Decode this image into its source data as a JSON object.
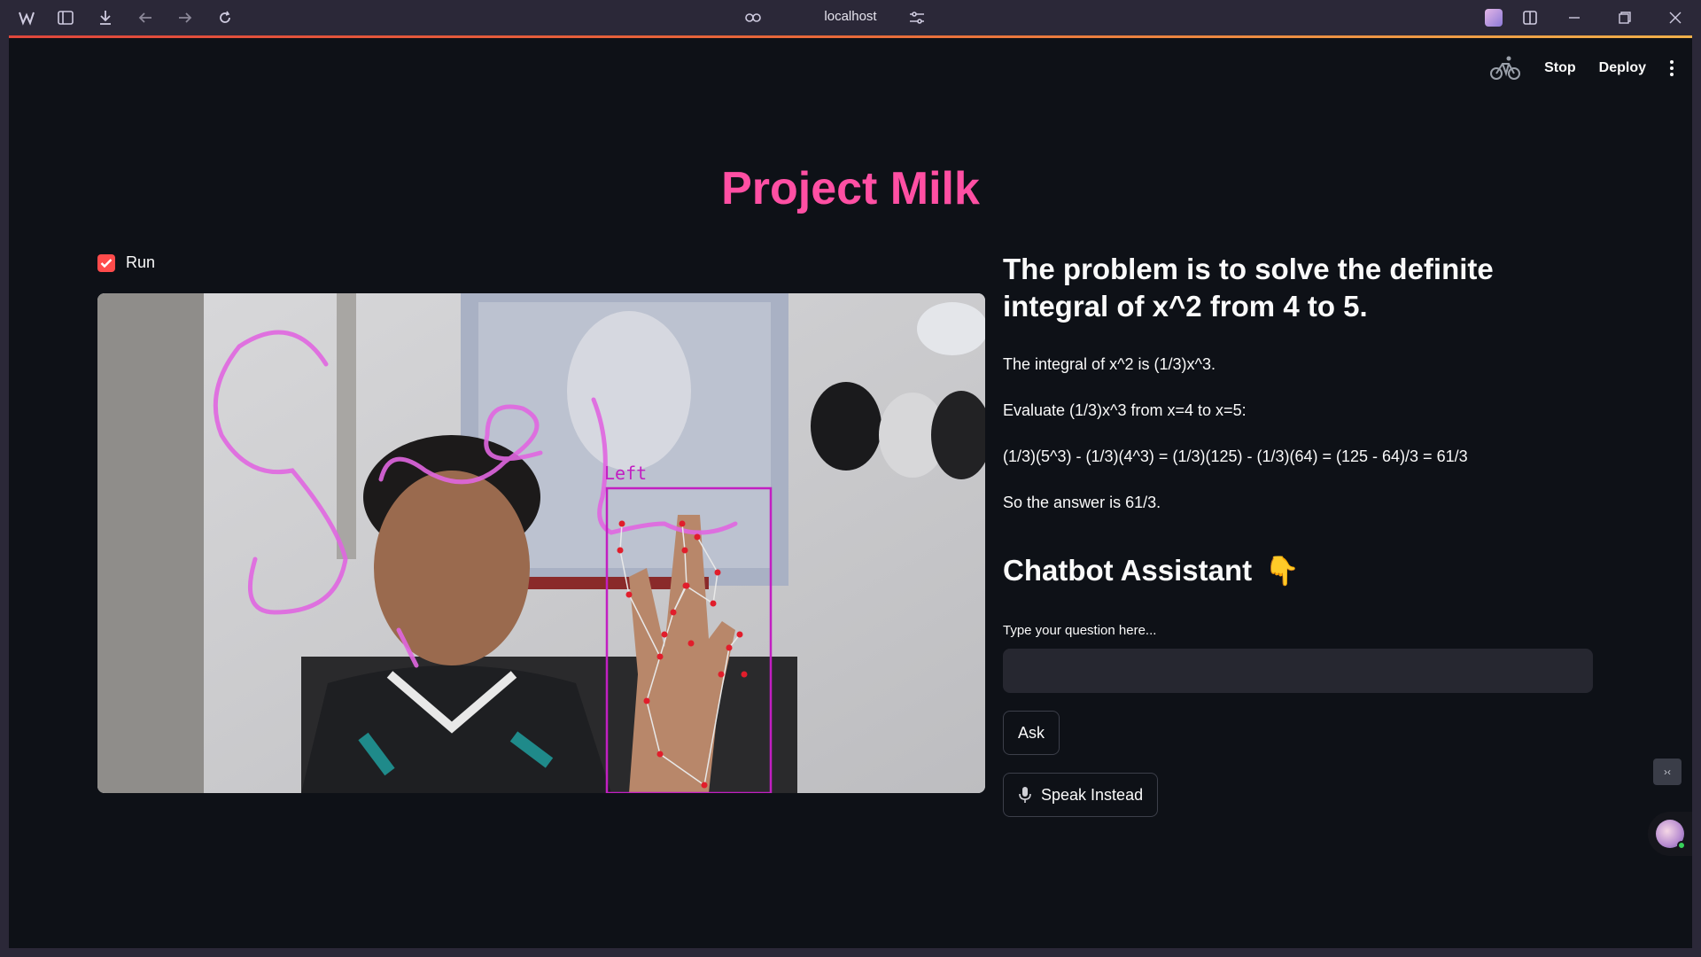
{
  "browser": {
    "address": "localhost"
  },
  "toolbar": {
    "stop_label": "Stop",
    "deploy_label": "Deploy"
  },
  "page": {
    "title": "Project Milk"
  },
  "run_toggle": {
    "label": "Run",
    "checked": true
  },
  "video": {
    "overlay_label": "Left"
  },
  "solution": {
    "problem": "The problem is to solve the definite integral of x^2 from 4 to 5.",
    "steps": [
      "The integral of x^2 is (1/3)x^3.",
      "Evaluate (1/3)x^3 from x=4 to x=5:",
      "(1/3)(5^3) - (1/3)(4^3) = (1/3)(125) - (1/3)(64) = (125 - 64)/3 = 61/3",
      "So the answer is 61/3."
    ]
  },
  "chatbot": {
    "heading": "Chatbot Assistant",
    "heading_emoji": "👇",
    "question_label": "Type your question here...",
    "question_value": "",
    "ask_label": "Ask",
    "speak_label": "Speak Instead"
  },
  "colors": {
    "accent": "#ff4fa3",
    "checkbox": "#ff4b4b",
    "background": "#0e1117",
    "input_bg": "#262730"
  }
}
